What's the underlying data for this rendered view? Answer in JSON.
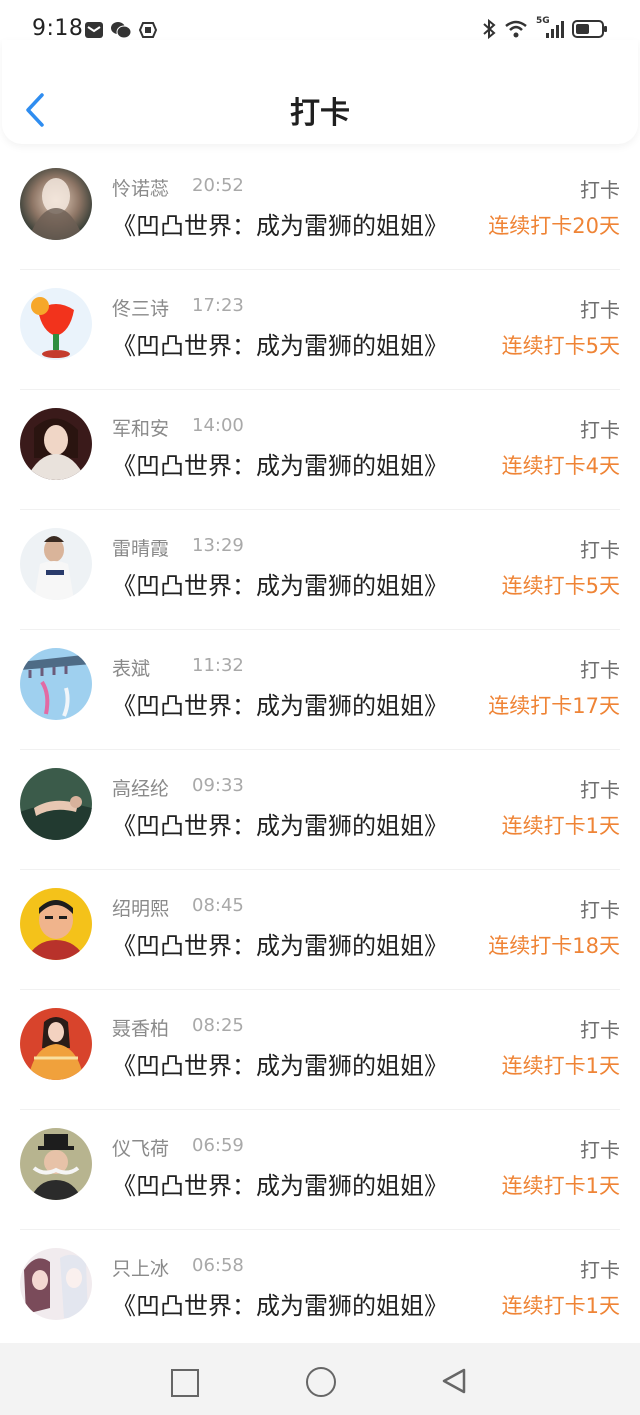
{
  "status_bar": {
    "time": "9:18",
    "left_icons": [
      "mail-icon",
      "wechat-icon",
      "sync-icon"
    ],
    "right_icons": [
      "bluetooth-icon",
      "wifi-icon",
      "signal-5g-icon",
      "battery-icon"
    ],
    "network_label": "5G"
  },
  "header": {
    "title": "打卡",
    "back_icon": "chevron-left-icon"
  },
  "colors": {
    "accent": "#ef8436",
    "back_arrow": "#2f8df0"
  },
  "list": {
    "items": [
      {
        "name": "怜诺蕊",
        "time": "20:52",
        "book": "《凹凸世界：成为雷狮的姐姐》",
        "action": "打卡",
        "streak": "连续打卡20天"
      },
      {
        "name": "佟三诗",
        "time": "17:23",
        "book": "《凹凸世界：成为雷狮的姐姐》",
        "action": "打卡",
        "streak": "连续打卡5天"
      },
      {
        "name": "军和安",
        "time": "14:00",
        "book": "《凹凸世界：成为雷狮的姐姐》",
        "action": "打卡",
        "streak": "连续打卡4天"
      },
      {
        "name": "雷晴霞",
        "time": "13:29",
        "book": "《凹凸世界：成为雷狮的姐姐》",
        "action": "打卡",
        "streak": "连续打卡5天"
      },
      {
        "name": "表斌",
        "time": "11:32",
        "book": "《凹凸世界：成为雷狮的姐姐》",
        "action": "打卡",
        "streak": "连续打卡17天"
      },
      {
        "name": "高经纶",
        "time": "09:33",
        "book": "《凹凸世界：成为雷狮的姐姐》",
        "action": "打卡",
        "streak": "连续打卡1天"
      },
      {
        "name": "绍明熙",
        "time": "08:45",
        "book": "《凹凸世界：成为雷狮的姐姐》",
        "action": "打卡",
        "streak": "连续打卡18天"
      },
      {
        "name": "聂香柏",
        "time": "08:25",
        "book": "《凹凸世界：成为雷狮的姐姐》",
        "action": "打卡",
        "streak": "连续打卡1天"
      },
      {
        "name": "仪飞荷",
        "time": "06:59",
        "book": "《凹凸世界：成为雷狮的姐姐》",
        "action": "打卡",
        "streak": "连续打卡1天"
      },
      {
        "name": "只上冰",
        "time": "06:58",
        "book": "《凹凸世界：成为雷狮的姐姐》",
        "action": "打卡",
        "streak": "连续打卡1天"
      }
    ]
  },
  "navigation_bar": {
    "buttons": [
      "recent-apps-icon",
      "home-icon",
      "back-icon"
    ]
  }
}
